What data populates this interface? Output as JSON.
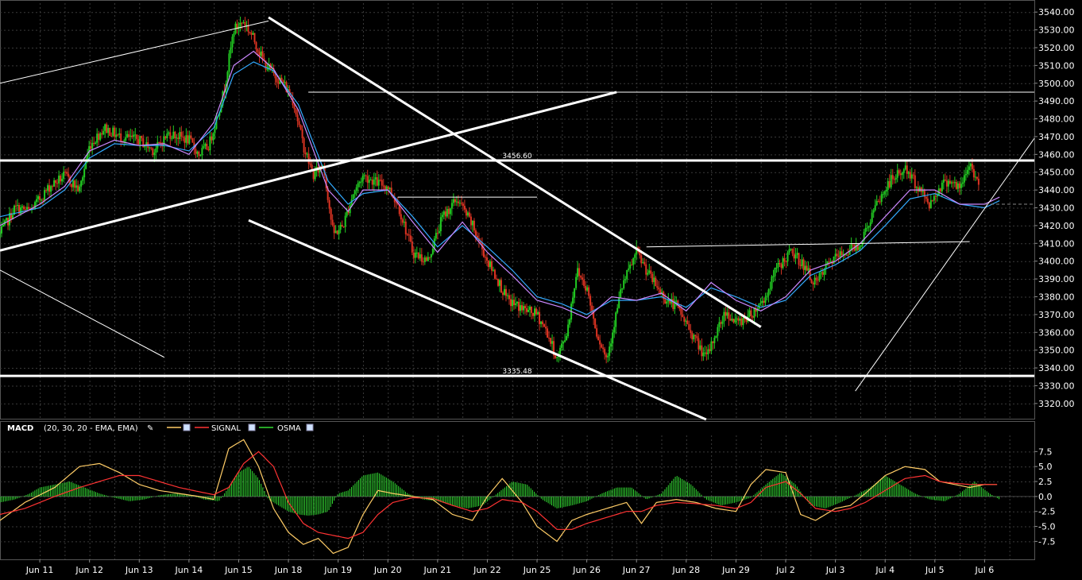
{
  "chart_data": [
    {
      "type": "candlestick",
      "panel": "price",
      "title": "",
      "ylim": [
        3311,
        3545
      ],
      "y_ticks": [
        3320,
        3330,
        3340,
        3350,
        3360,
        3370,
        3380,
        3390,
        3400,
        3410,
        3420,
        3430,
        3440,
        3450,
        3460,
        3470,
        3480,
        3490,
        3500,
        3510,
        3520,
        3530,
        3540
      ],
      "y_tick_labels": [
        "3320.00",
        "3330.00",
        "3340.00",
        "3350.00",
        "3360.00",
        "3370.00",
        "3380.00",
        "3390.00",
        "3400.00",
        "3410.00",
        "3420.00",
        "3430.00",
        "3440.00",
        "3450.00",
        "3460.00",
        "3470.00",
        "3480.00",
        "3490.00",
        "3500.00",
        "3510.00",
        "3520.00",
        "3530.00",
        "3540.00"
      ],
      "x_categories": [
        "Jun 11",
        "Jun 12",
        "Jun 13",
        "Jun 14",
        "Jun 15",
        "Jun 18",
        "Jun 19",
        "Jun 20",
        "Jun 21",
        "Jun 22",
        "Jun 25",
        "Jun 26",
        "Jun 27",
        "Jun 28",
        "Jun 29",
        "Jul 2",
        "Jul 3",
        "Jul 4",
        "Jul 5",
        "Jul 6"
      ],
      "x_range": [
        -0.8,
        20.0
      ],
      "grid": true,
      "price_path": {
        "x": [
          -0.8,
          -0.5,
          -0.2,
          0.2,
          0.5,
          0.8,
          1.0,
          1.3,
          1.6,
          2.0,
          2.3,
          2.6,
          3.0,
          3.2,
          3.4,
          3.7,
          3.9,
          4.1,
          4.3,
          4.5,
          4.7,
          4.9,
          5.1,
          5.3,
          5.5,
          5.7,
          5.9,
          6.1,
          6.3,
          6.5,
          6.8,
          7.0,
          7.2,
          7.5,
          7.8,
          8.1,
          8.4,
          8.7,
          9.0,
          9.2,
          9.4,
          9.6,
          9.8,
          10.0,
          10.2,
          10.4,
          10.6,
          10.8,
          11.0,
          11.2,
          11.4,
          11.7,
          12.0,
          12.3,
          12.6,
          12.8,
          13.0,
          13.2,
          13.4,
          13.6,
          13.8,
          14.0,
          14.3,
          14.6,
          14.8,
          15.1,
          15.3,
          15.6,
          15.9,
          16.2,
          16.5,
          16.8,
          17.1,
          17.4,
          17.7,
          17.9,
          18.1,
          18.3,
          18.5,
          18.7,
          18.9,
          19.1,
          19.2,
          19.3
        ],
        "y": [
          3415,
          3430,
          3428,
          3442,
          3448,
          3440,
          3465,
          3475,
          3470,
          3468,
          3462,
          3472,
          3468,
          3460,
          3465,
          3495,
          3530,
          3535,
          3525,
          3512,
          3505,
          3500,
          3490,
          3465,
          3448,
          3455,
          3415,
          3420,
          3438,
          3448,
          3444,
          3442,
          3432,
          3405,
          3400,
          3425,
          3435,
          3420,
          3400,
          3390,
          3378,
          3375,
          3372,
          3370,
          3360,
          3345,
          3360,
          3395,
          3385,
          3360,
          3345,
          3385,
          3405,
          3390,
          3378,
          3375,
          3365,
          3355,
          3345,
          3360,
          3372,
          3365,
          3370,
          3380,
          3395,
          3405,
          3400,
          3387,
          3400,
          3405,
          3410,
          3430,
          3445,
          3452,
          3440,
          3432,
          3442,
          3446,
          3440,
          3455,
          3442
        ]
      },
      "ema_fast": {
        "name": "",
        "color": "#cc88ff",
        "x": [
          -0.8,
          0.0,
          0.5,
          1.0,
          1.5,
          2.0,
          2.5,
          3.0,
          3.5,
          3.9,
          4.3,
          4.7,
          5.2,
          5.8,
          6.2,
          6.5,
          7.0,
          7.5,
          8.0,
          8.5,
          9.0,
          9.5,
          10.0,
          10.5,
          11.0,
          11.5,
          12.0,
          12.5,
          13.0,
          13.5,
          14.0,
          14.5,
          15.0,
          15.5,
          16.0,
          16.5,
          17.0,
          17.5,
          18.0,
          18.5,
          19.0,
          19.3
        ],
        "y": [
          3420,
          3432,
          3442,
          3462,
          3468,
          3465,
          3466,
          3460,
          3478,
          3510,
          3518,
          3508,
          3485,
          3440,
          3428,
          3440,
          3440,
          3422,
          3405,
          3422,
          3405,
          3392,
          3378,
          3374,
          3368,
          3380,
          3378,
          3382,
          3372,
          3388,
          3378,
          3372,
          3380,
          3395,
          3400,
          3410,
          3425,
          3440,
          3440,
          3432,
          3432,
          3436
        ]
      },
      "ema_slow": {
        "name": "",
        "color": "#33aaff",
        "x": [
          -0.8,
          0.0,
          0.5,
          1.0,
          1.5,
          2.0,
          2.5,
          3.0,
          3.5,
          3.9,
          4.3,
          4.7,
          5.2,
          5.8,
          6.2,
          6.5,
          7.0,
          7.5,
          8.0,
          8.5,
          9.0,
          9.5,
          10.0,
          10.5,
          11.0,
          11.5,
          12.0,
          12.5,
          13.0,
          13.5,
          14.0,
          14.5,
          15.0,
          15.5,
          16.0,
          16.5,
          17.0,
          17.5,
          18.0,
          18.5,
          19.0,
          19.3
        ],
        "y": [
          3425,
          3430,
          3440,
          3458,
          3466,
          3465,
          3465,
          3462,
          3475,
          3505,
          3512,
          3507,
          3488,
          3445,
          3432,
          3438,
          3440,
          3425,
          3408,
          3420,
          3408,
          3395,
          3380,
          3376,
          3370,
          3378,
          3378,
          3380,
          3374,
          3385,
          3380,
          3374,
          3378,
          3392,
          3398,
          3406,
          3420,
          3435,
          3438,
          3432,
          3430,
          3434
        ]
      },
      "annotations": [
        {
          "label": "3456.60",
          "value": 3456.6
        },
        {
          "label": "3335.48",
          "value": 3335.48
        }
      ],
      "trend_lines": [
        {
          "from": [
            -0.8,
            3500
          ],
          "to": [
            4.6,
            3535
          ],
          "width": 1
        },
        {
          "from": [
            4.6,
            3537
          ],
          "to": [
            14.5,
            3363
          ],
          "width": 3
        },
        {
          "from": [
            4.2,
            3423
          ],
          "to": [
            13.4,
            3311
          ],
          "width": 3
        },
        {
          "from": [
            -0.8,
            3406
          ],
          "to": [
            11.6,
            3495
          ],
          "width": 3
        },
        {
          "from": [
            5.4,
            3495
          ],
          "to": [
            20.0,
            3495
          ],
          "width": 1
        },
        {
          "from": [
            7.2,
            3436
          ],
          "to": [
            10.0,
            3436
          ],
          "width": 1
        },
        {
          "from": [
            12.2,
            3408
          ],
          "to": [
            18.7,
            3411
          ],
          "width": 1
        },
        {
          "from": [
            16.4,
            3327
          ],
          "to": [
            20.0,
            3469
          ],
          "width": 1
        },
        {
          "from": [
            -0.8,
            3395
          ],
          "to": [
            2.5,
            3346
          ],
          "width": 1
        }
      ]
    },
    {
      "type": "line",
      "panel": "indicator",
      "title": "MACD",
      "params": "(20, 30, 20 - EMA, EMA)",
      "ylim": [
        -10.5,
        10.2
      ],
      "y_ticks": [
        -7.5,
        -5,
        -2.5,
        0,
        2.5,
        5,
        7.5
      ],
      "y_tick_labels": [
        "-7.5",
        "-5.0",
        "-2.5",
        "0.0",
        "2.5",
        "5.0",
        "7.5"
      ],
      "x_range": [
        -0.8,
        20.0
      ],
      "series": [
        {
          "name": "",
          "color": "#ffcc66",
          "x": [
            -0.8,
            -0.3,
            0.3,
            0.8,
            1.2,
            1.6,
            2.0,
            2.4,
            2.8,
            3.2,
            3.5,
            3.8,
            4.1,
            4.4,
            4.7,
            5.0,
            5.3,
            5.6,
            5.9,
            6.2,
            6.5,
            6.8,
            7.1,
            7.5,
            7.9,
            8.3,
            8.7,
            9.0,
            9.3,
            9.7,
            10.0,
            10.4,
            10.7,
            11.0,
            11.4,
            11.8,
            12.1,
            12.4,
            12.8,
            13.2,
            13.6,
            14.0,
            14.3,
            14.6,
            15.0,
            15.3,
            15.6,
            16.0,
            16.3,
            16.6,
            17.0,
            17.4,
            17.8,
            18.1,
            18.4,
            18.7,
            19.0,
            19.3
          ],
          "y": [
            -4,
            -1,
            1.5,
            5.0,
            5.5,
            4.0,
            2.0,
            1.0,
            0.5,
            0.0,
            -0.5,
            8.0,
            9.5,
            5.0,
            -2.0,
            -6.0,
            -8.0,
            -7.0,
            -9.5,
            -8.5,
            -3.0,
            1.0,
            0.5,
            0,
            -0.5,
            -3,
            -4,
            0,
            3.0,
            -1,
            -5,
            -7.5,
            -4,
            -3,
            -2,
            -1,
            -4.5,
            -1,
            -0.5,
            -1.0,
            -2.0,
            -2.5,
            2.0,
            4.5,
            4.0,
            -3.0,
            -4.0,
            -2,
            -1.5,
            0.5,
            3.5,
            5.0,
            4.5,
            2.5,
            2.0,
            1.5,
            2.0,
            2.0
          ]
        },
        {
          "name": "SIGNAL",
          "color": "#ff3333",
          "x": [
            -0.8,
            -0.3,
            0.3,
            0.8,
            1.2,
            1.6,
            2.0,
            2.4,
            2.8,
            3.2,
            3.5,
            3.8,
            4.1,
            4.4,
            4.7,
            5.0,
            5.3,
            5.6,
            5.9,
            6.2,
            6.5,
            6.8,
            7.1,
            7.5,
            7.9,
            8.3,
            8.7,
            9.0,
            9.3,
            9.7,
            10.0,
            10.4,
            10.7,
            11.0,
            11.4,
            11.8,
            12.1,
            12.4,
            12.8,
            13.2,
            13.6,
            14.0,
            14.3,
            14.6,
            15.0,
            15.3,
            15.6,
            16.0,
            16.3,
            16.6,
            17.0,
            17.4,
            17.8,
            18.1,
            18.4,
            18.7,
            19.0,
            19.3
          ],
          "y": [
            -3,
            -2,
            0,
            1.5,
            2.5,
            3.5,
            3.5,
            2.5,
            1.5,
            0.8,
            0.3,
            1.5,
            5.5,
            7.5,
            5.0,
            -1.0,
            -4.5,
            -6.0,
            -6.5,
            -7.0,
            -6.0,
            -3.0,
            -1.0,
            -0.2,
            -0.3,
            -1.5,
            -2.5,
            -2.0,
            -0.5,
            -1.0,
            -2.5,
            -5.5,
            -5.5,
            -4.5,
            -3.5,
            -2.5,
            -2.5,
            -1.5,
            -1.0,
            -1.2,
            -1.5,
            -2.0,
            -1.0,
            1.5,
            2.5,
            0.5,
            -2.0,
            -2.5,
            -2.0,
            -1.0,
            1.0,
            3.0,
            3.5,
            2.5,
            2.2,
            2.0,
            2.0,
            2.0
          ]
        }
      ],
      "osma": {
        "name": "OSMA",
        "color": "#33dd33",
        "x": [
          -0.8,
          -0.5,
          -0.2,
          0.0,
          0.3,
          0.6,
          0.9,
          1.2,
          1.5,
          1.8,
          2.1,
          2.4,
          2.7,
          3.0,
          3.3,
          3.6,
          3.8,
          4.0,
          4.2,
          4.4,
          4.6,
          4.8,
          5.0,
          5.2,
          5.4,
          5.6,
          5.8,
          6.0,
          6.2,
          6.5,
          6.8,
          7.1,
          7.4,
          7.7,
          8.0,
          8.3,
          8.6,
          8.9,
          9.2,
          9.5,
          9.8,
          10.1,
          10.4,
          10.7,
          11.0,
          11.3,
          11.6,
          11.9,
          12.2,
          12.5,
          12.8,
          13.1,
          13.4,
          13.7,
          14.0,
          14.3,
          14.6,
          14.9,
          15.2,
          15.5,
          15.8,
          16.1,
          16.4,
          16.7,
          17.0,
          17.3,
          17.6,
          17.9,
          18.2,
          18.5,
          18.8,
          19.1,
          19.3
        ],
        "y": [
          -1,
          -0.5,
          0.5,
          1.5,
          2.0,
          2.5,
          1.5,
          0.5,
          -0.2,
          -0.8,
          -0.5,
          0.2,
          0.5,
          0.3,
          -0.5,
          -0.8,
          1.5,
          4.0,
          5.0,
          3.0,
          -0.5,
          -1.5,
          -2.5,
          -3.0,
          -3.2,
          -3.0,
          -2.5,
          0.5,
          1.0,
          3.5,
          4.0,
          2.5,
          0.5,
          -0.5,
          -0.8,
          -1.5,
          -2.0,
          -1.5,
          0.5,
          2.5,
          2.0,
          -0.5,
          -2.0,
          -1.5,
          -0.8,
          0.5,
          1.5,
          1.5,
          -0.5,
          0.5,
          3.5,
          2.0,
          -0.5,
          -1.5,
          -1.0,
          -0.2,
          2.0,
          4.0,
          2.0,
          -1.5,
          -2.0,
          -1.0,
          0.2,
          1.5,
          3.5,
          2.0,
          0.5,
          -0.5,
          -0.8,
          0.5,
          2.5,
          0.5,
          -0.5
        ]
      }
    }
  ],
  "legend": {
    "indicator_name": "MACD",
    "params": "(20, 30, 20 - EMA, EMA)",
    "signal_label": "SIGNAL",
    "osma_label": "OSMA"
  }
}
